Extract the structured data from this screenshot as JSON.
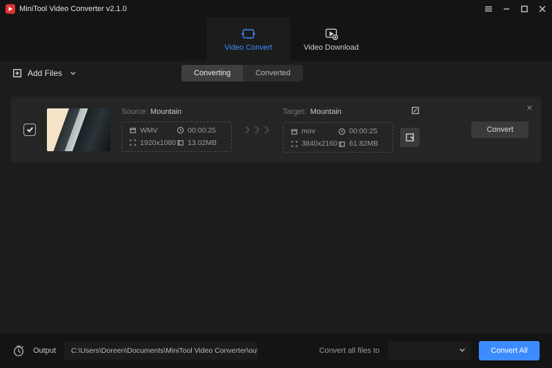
{
  "titlebar": {
    "title": "MiniTool Video Converter v2.1.0"
  },
  "maintabs": {
    "convert": "Video Convert",
    "download": "Video Download"
  },
  "toolbar": {
    "add_files": "Add Files",
    "subtab_converting": "Converting",
    "subtab_converted": "Converted"
  },
  "job": {
    "source_label": "Source:",
    "source_name": "Mountain",
    "source_format": "WMV",
    "source_duration": "00:00:25",
    "source_resolution": "1920x1080",
    "source_size": "13.02MB",
    "target_label": "Target:",
    "target_name": "Mountain",
    "target_format": "mov",
    "target_duration": "00:00:25",
    "target_resolution": "3840x2160",
    "target_size": "61.82MB",
    "convert_btn": "Convert"
  },
  "footer": {
    "output_label": "Output",
    "output_path": "C:\\Users\\Doreen\\Documents\\MiniTool Video Converter\\outpu",
    "convert_all_label": "Convert all files to",
    "convert_all_btn": "Convert All"
  }
}
